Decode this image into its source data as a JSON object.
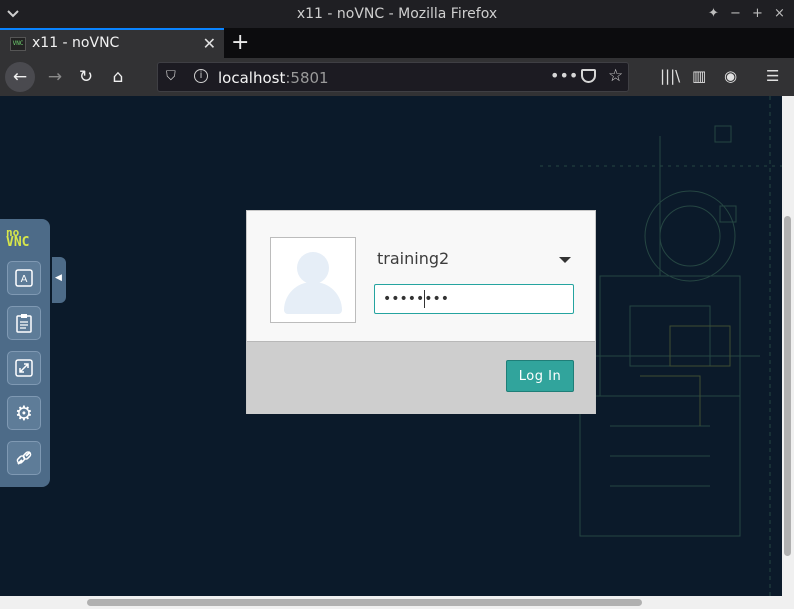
{
  "window": {
    "title": "x11 - noVNC - Mozilla Firefox"
  },
  "tabs": [
    {
      "label": "x11 - noVNC",
      "favicon": "vnc-favicon-icon",
      "active": true
    }
  ],
  "navbar": {
    "url_host": "localhost",
    "url_port": ":5801"
  },
  "login": {
    "username": "training2",
    "password_mask": "••••••••",
    "login_button": "Log In"
  },
  "vnc_panel": {
    "logo_top": "no",
    "logo_bottom": "VNC",
    "buttons": [
      "keyboard-icon",
      "clipboard-icon",
      "fullscreen-icon",
      "settings-icon",
      "disconnect-icon"
    ]
  },
  "colors": {
    "accent": "#31a49c",
    "panel": "#4d6b88",
    "background": "#0b1a2a"
  }
}
